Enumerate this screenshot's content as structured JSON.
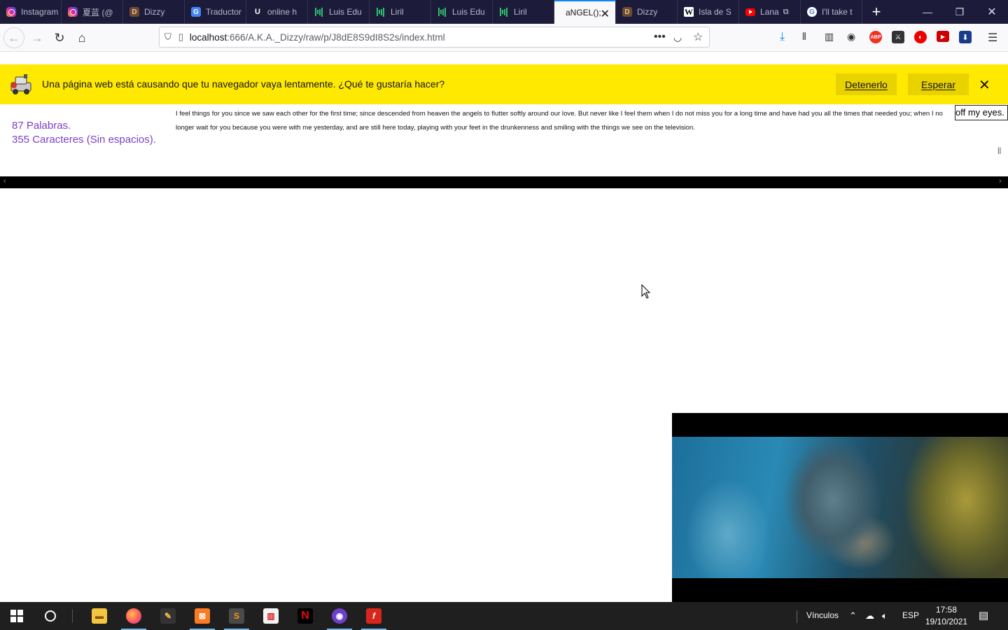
{
  "tabs": [
    {
      "label": "Instagram",
      "icon": "instagram-icon",
      "kind": "ig"
    },
    {
      "label": "夏蓝 (@",
      "icon": "instagram-icon",
      "kind": "ig"
    },
    {
      "label": "Dizzy",
      "icon": "dizzy-favicon",
      "kind": "dz"
    },
    {
      "label": "Traductor",
      "icon": "google-translate-icon",
      "kind": "gt"
    },
    {
      "label": "online h",
      "icon": "ul-favicon",
      "kind": "ul"
    },
    {
      "label": "Luis Edu",
      "icon": "bars-favicon",
      "kind": "bars"
    },
    {
      "label": "Liril",
      "icon": "bars-favicon",
      "kind": "bars"
    },
    {
      "label": "Luis Edu",
      "icon": "bars-favicon",
      "kind": "bars"
    },
    {
      "label": "Liril",
      "icon": "bars-favicon",
      "kind": "bars"
    },
    {
      "label": "aNGEL();",
      "icon": "",
      "kind": "active"
    },
    {
      "label": "Dizzy",
      "icon": "dizzy-favicon",
      "kind": "dz"
    },
    {
      "label": "Isla de S",
      "icon": "wikipedia-icon",
      "kind": "wk"
    },
    {
      "label": "Lana",
      "icon": "youtube-icon",
      "kind": "yt"
    },
    {
      "label": "I'll take t",
      "icon": "google-icon",
      "kind": "gg"
    }
  ],
  "nav": {
    "url_host": "localhost",
    "url_path": ":666/A.K.A._Dizzy/raw/p/J8dE8S9dI8S2s/index.html"
  },
  "notification": {
    "message": "Una página web está causando que tu navegador vaya lentamente. ¿Qué te gustaría hacer?",
    "stop_label": "Detenerlo",
    "wait_label": "Esperar"
  },
  "stats": {
    "words": "87 Palabras.",
    "chars": "355 Caracteres (Sin espacios)."
  },
  "poem": "I feel things for you since we saw each other for the first time; since descended from heaven the angels to flutter softly around our love. But never like I feel them when I do not miss you for a long time and have had you all the times that needed you; when I no longer wait for you because you were with me yesterday, and are still here today, playing with your feet in the drunkenness and smiling with the things we see on the television.",
  "marquee_text": "off my eyes.",
  "pause_glyph": "||",
  "taskbar": {
    "links_label": "Vínculos",
    "lang": "ESP",
    "time": "17:58",
    "date": "19/10/2021"
  },
  "colors": {
    "tabstrip": "#1c1b3a",
    "notification_bg": "#ffe900",
    "stats_text": "#7b3fc6",
    "accent": "#0a84ff"
  }
}
